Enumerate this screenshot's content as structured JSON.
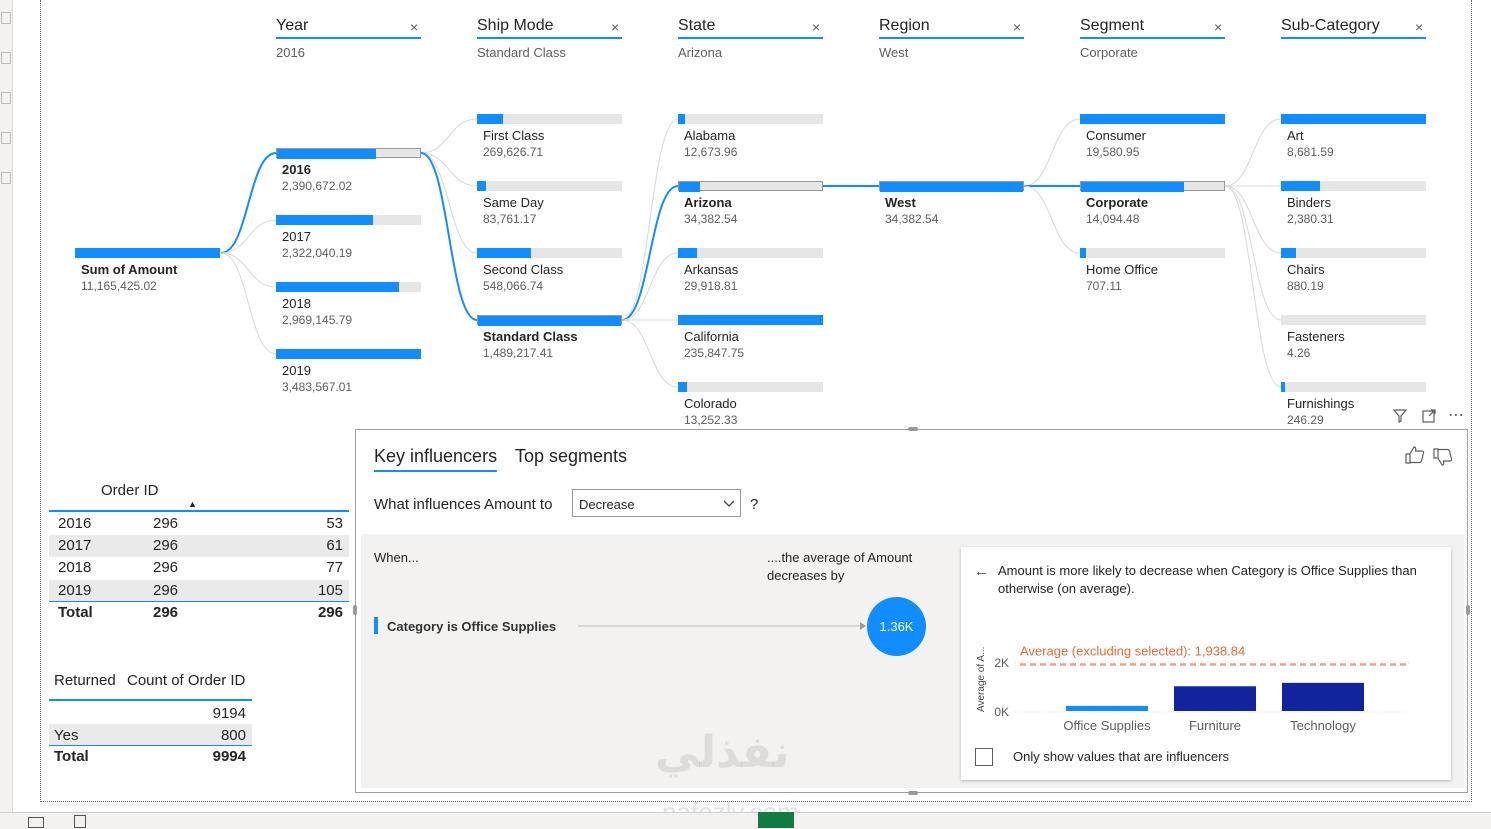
{
  "tree": {
    "columns": [
      {
        "name": "Year",
        "filter": "2016"
      },
      {
        "name": "Ship Mode",
        "filter": "Standard Class"
      },
      {
        "name": "State",
        "filter": "Arizona"
      },
      {
        "name": "Region",
        "filter": "West"
      },
      {
        "name": "Segment",
        "filter": "Corporate"
      },
      {
        "name": "Sub-Category",
        "filter": ""
      }
    ],
    "close_glyph": "×",
    "root": {
      "label": "Sum of Amount",
      "value": "11,165,425.02"
    },
    "year_nodes": [
      {
        "label": "2016",
        "value": "2,390,672.02",
        "fill": 0.69,
        "selected": true
      },
      {
        "label": "2017",
        "value": "2,322,040.19",
        "fill": 0.67,
        "selected": false
      },
      {
        "label": "2018",
        "value": "2,969,145.79",
        "fill": 0.85,
        "selected": false
      },
      {
        "label": "2019",
        "value": "3,483,567.01",
        "fill": 1.0,
        "selected": false
      }
    ],
    "ship_nodes": [
      {
        "label": "First Class",
        "value": "269,626.71",
        "fill": 0.18,
        "selected": false
      },
      {
        "label": "Same Day",
        "value": "83,761.17",
        "fill": 0.06,
        "selected": false
      },
      {
        "label": "Second Class",
        "value": "548,066.74",
        "fill": 0.37,
        "selected": false
      },
      {
        "label": "Standard Class",
        "value": "1,489,217.41",
        "fill": 1.0,
        "selected": true
      }
    ],
    "state_nodes": [
      {
        "label": "Alabama",
        "value": "12,673.96",
        "fill": 0.05,
        "selected": false
      },
      {
        "label": "Arizona",
        "value": "34,382.54",
        "fill": 0.15,
        "selected": true
      },
      {
        "label": "Arkansas",
        "value": "29,918.81",
        "fill": 0.13,
        "selected": false
      },
      {
        "label": "California",
        "value": "235,847.75",
        "fill": 1.0,
        "selected": false
      },
      {
        "label": "Colorado",
        "value": "13,252.33",
        "fill": 0.06,
        "selected": false
      }
    ],
    "region_nodes": [
      {
        "label": "West",
        "value": "34,382.54",
        "fill": 1.0,
        "selected": true
      }
    ],
    "segment_nodes": [
      {
        "label": "Consumer",
        "value": "19,580.95",
        "fill": 1.0,
        "selected": false
      },
      {
        "label": "Corporate",
        "value": "14,094.48",
        "fill": 0.72,
        "selected": true
      },
      {
        "label": "Home Office",
        "value": "707.11",
        "fill": 0.04,
        "selected": false
      }
    ],
    "subcat_nodes": [
      {
        "label": "Art",
        "value": "8,681.59",
        "fill": 1.0
      },
      {
        "label": "Binders",
        "value": "2,380.31",
        "fill": 0.27
      },
      {
        "label": "Chairs",
        "value": "880.19",
        "fill": 0.1
      },
      {
        "label": "Fasteners",
        "value": "4.26",
        "fill": 0.0
      },
      {
        "label": "Furnishings",
        "value": "246.29",
        "fill": 0.03
      }
    ]
  },
  "table1": {
    "header": "Order ID",
    "sort_glyph": "▲",
    "rows": [
      {
        "year": "2016",
        "a": "296",
        "b": "53"
      },
      {
        "year": "2017",
        "a": "296",
        "b": "61"
      },
      {
        "year": "2018",
        "a": "296",
        "b": "77"
      },
      {
        "year": "2019",
        "a": "296",
        "b": "105"
      }
    ],
    "total": {
      "label": "Total",
      "a": "296",
      "b": "296"
    }
  },
  "table2": {
    "col1": "Returned",
    "col2": "Count of Order ID",
    "rows": [
      {
        "label": "",
        "value": "9194"
      },
      {
        "label": "Yes",
        "value": "800"
      }
    ],
    "total": {
      "label": "Total",
      "value": "9994"
    }
  },
  "key_influencers": {
    "tabs": [
      "Key influencers",
      "Top segments"
    ],
    "question": "What influences Amount to",
    "dropdown_value": "Decrease",
    "help": "?",
    "when_label": "When...",
    "avg_label_1": "....the average of Amount",
    "avg_label_2": "decreases by",
    "influencer": "Category is Office Supplies",
    "bubble": "1.36K",
    "detail_text_1": "Amount is more likely to decrease when Category is Office Supplies than",
    "detail_text_2": "otherwise (on average).",
    "avg_line_label": "Average (excluding selected): 1,938.84",
    "checkbox_label": "Only show values that are influencers"
  },
  "chart_data": {
    "type": "bar",
    "categories": [
      "Office Supplies",
      "Furniture",
      "Technology"
    ],
    "values": [
      250,
      1050,
      1190
    ],
    "ylabel": "Average of A...",
    "y_ticks": [
      "2K",
      "0K"
    ],
    "ylim": [
      0,
      2200
    ],
    "reference_line": 1938.84,
    "colors": [
      "#118dff",
      "#12239e",
      "#12239e"
    ]
  },
  "watermark": {
    "arabic": "نفذلي",
    "latin": "nafezly.com"
  },
  "colors": {
    "accent": "#118dff",
    "dark_bar": "#12239e",
    "orange": "#e66c37"
  }
}
